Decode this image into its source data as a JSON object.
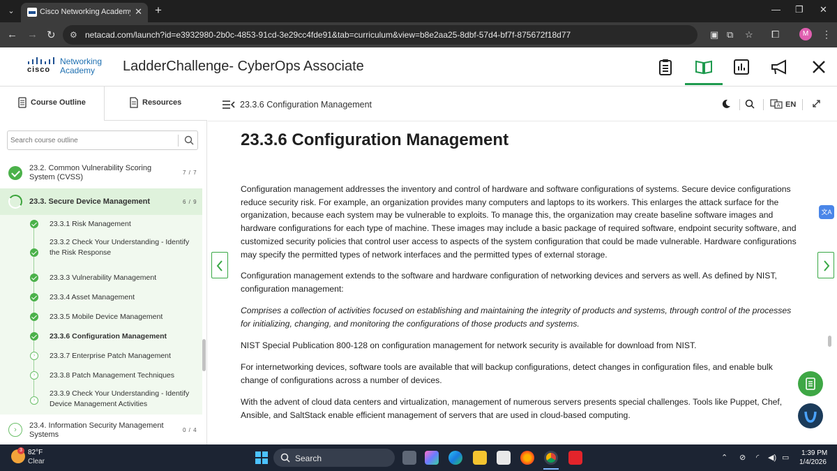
{
  "browser": {
    "tab_title": "Cisco Networking Academy: La",
    "url": "netacad.com/launch?id=e3932980-2b0c-4853-91cd-3e29cc4fde91&tab=curriculum&view=b8e2aa25-8dbf-57d4-bf7f-875672f18d77",
    "profile_initial": "M"
  },
  "header": {
    "logo_word": "cisco",
    "logo_line1": "Networking",
    "logo_line2": "Academy",
    "title": "LadderChallenge- CyberOps Associate"
  },
  "sidebar": {
    "tab_outline": "Course Outline",
    "tab_resources": "Resources",
    "search_placeholder": "Search course outline",
    "sections": [
      {
        "title": "23.2. Common Vulnerability Scoring System (CVSS)",
        "count": "7 / 7"
      },
      {
        "title": "23.3. Secure Device Management",
        "count": "6 / 9"
      },
      {
        "title": "23.4. Information Security Management Systems",
        "count": "0 / 4"
      }
    ],
    "items": [
      {
        "label": "23.3.1 Risk Management"
      },
      {
        "label": "23.3.2 Check Your Understanding - Identify the Risk Response"
      },
      {
        "label": "23.3.3 Vulnerability Management"
      },
      {
        "label": "23.3.4 Asset Management"
      },
      {
        "label": "23.3.5 Mobile Device Management"
      },
      {
        "label": "23.3.6 Configuration Management"
      },
      {
        "label": "23.3.7 Enterprise Patch Management"
      },
      {
        "label": "23.3.8 Patch Management Techniques"
      },
      {
        "label": "23.3.9 Check Your Understanding - Identify Device Management Activities"
      }
    ]
  },
  "content": {
    "breadcrumb": "23.3.6 Configuration Management",
    "language": "EN",
    "heading": "23.3.6 Configuration Management",
    "p1": "Configuration management addresses the inventory and control of hardware and software configurations of systems. Secure device configurations reduce security risk. For example, an organization provides many computers and laptops to its workers. This enlarges the attack surface for the organization, because each system may be vulnerable to exploits. To manage this, the organization may create baseline software images and hardware configurations for each type of machine. These images may include a basic package of required software, endpoint security software, and customized security policies that control user access to aspects of the system configuration that could be made vulnerable. Hardware configurations may specify the permitted types of network interfaces and the permitted types of external storage.",
    "p2": "Configuration management extends to the software and hardware configuration of networking devices and servers as well. As defined by NIST, configuration management:",
    "p3": "Comprises a collection of activities focused on establishing and maintaining the integrity of products and systems, through control of the processes for initializing, changing, and monitoring the configurations of those products and systems.",
    "p4": "NIST Special Publication 800-128 on configuration management for network security is available for download from NIST.",
    "p5": "For internetworking devices, software tools are available that will backup configurations, detect changes in configuration files, and enable bulk change of configurations across a number of devices.",
    "p6": "With the advent of cloud data centers and virtualization, management of numerous servers presents special challenges. Tools like Puppet, Chef, Ansible, and SaltStack enable efficient management of servers that are used in cloud-based computing."
  },
  "taskbar": {
    "temperature": "82°F",
    "weather": "Clear",
    "weather_badge": "3",
    "search": "Search",
    "time": "1:39 PM",
    "date": "1/4/2026"
  },
  "colors": {
    "accent": "#39a845",
    "brand_blue": "#1d4f91",
    "sidebar_active": "#dff2dc",
    "sidebar_sub": "#f1f9ef"
  }
}
